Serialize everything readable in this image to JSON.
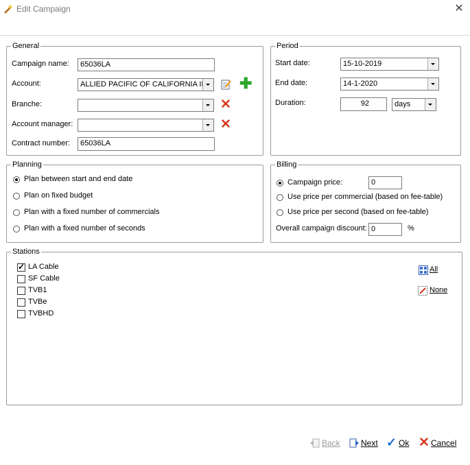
{
  "window": {
    "title": "Edit Campaign",
    "close_glyph": "✕"
  },
  "general": {
    "legend": "General",
    "campaign_name_label": "Campaign name:",
    "campaign_name_value": "65036LA",
    "account_label": "Account:",
    "account_value": "ALLIED PACIFIC OF CALIFORNIA IP.",
    "branche_label": "Branche:",
    "branche_value": "",
    "account_manager_label": "Account manager:",
    "account_manager_value": "",
    "contract_number_label": "Contract number:",
    "contract_number_value": "65036LA"
  },
  "period": {
    "legend": "Period",
    "start_label": "Start date:",
    "start_value": "15-10-2019",
    "end_label": "End date:",
    "end_value": "14-1-2020",
    "duration_label": "Duration:",
    "duration_value": "92",
    "duration_unit": "days"
  },
  "planning": {
    "legend": "Planning",
    "options": [
      {
        "label": "Plan between start and end date",
        "selected": true
      },
      {
        "label": "Plan on fixed budget",
        "selected": false
      },
      {
        "label": "Plan with a fixed number of commercials",
        "selected": false
      },
      {
        "label": "Plan with a fixed number of seconds",
        "selected": false
      }
    ]
  },
  "billing": {
    "legend": "Billing",
    "campaign_price_label": "Campaign price:",
    "campaign_price_value": "0",
    "per_commercial_label": "Use price per commercial (based on fee-table)",
    "per_second_label": "Use price per second (based on fee-table)",
    "discount_label": "Overall campaign discount:",
    "discount_value": "0",
    "percent": "%"
  },
  "stations": {
    "legend": "Stations",
    "items": [
      {
        "label": "LA Cable",
        "checked": true
      },
      {
        "label": "SF Cable",
        "checked": false
      },
      {
        "label": "TVB1",
        "checked": false
      },
      {
        "label": "TVBe",
        "checked": false
      },
      {
        "label": "TVBHD",
        "checked": false
      }
    ],
    "all_label": "All",
    "none_label": "None"
  },
  "footer": {
    "back_label": "Back",
    "next_label": "Next",
    "ok_label": "Ok",
    "cancel_label": "Cancel"
  },
  "colors": {
    "red_x": "#d83a1e",
    "green_plus": "#2aa52a",
    "ok_check": "#1e6fd0"
  }
}
